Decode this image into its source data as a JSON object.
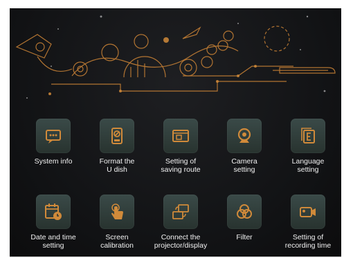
{
  "screen": {
    "accent": "#d08a3a",
    "tile_bg": "#33403d",
    "row1": [
      {
        "name": "system-info",
        "icon": "chat-bubble-icon",
        "label": "System info"
      },
      {
        "name": "format-u-dish",
        "icon": "usb-drive-icon",
        "label": "Format the\nU dish"
      },
      {
        "name": "saving-route",
        "icon": "folder-window-icon",
        "label": "Setting of\nsaving route"
      },
      {
        "name": "camera-setting",
        "icon": "webcam-icon",
        "label": "Camera\nsetting"
      },
      {
        "name": "language-setting",
        "icon": "letter-e-icon",
        "label": "Language\nsetting"
      }
    ],
    "row2": [
      {
        "name": "date-time-setting",
        "icon": "calendar-clock-icon",
        "label": "Date and time\nsetting"
      },
      {
        "name": "screen-calibration",
        "icon": "touch-hand-icon",
        "label": "Screen\ncalibration"
      },
      {
        "name": "connect-projector",
        "icon": "projector-icon",
        "label": "Connect the\nprojector/display"
      },
      {
        "name": "filter",
        "icon": "color-filter-icon",
        "label": "Filter"
      },
      {
        "name": "recording-time",
        "icon": "video-camera-icon",
        "label": "Setting of\nrecording time"
      }
    ]
  }
}
